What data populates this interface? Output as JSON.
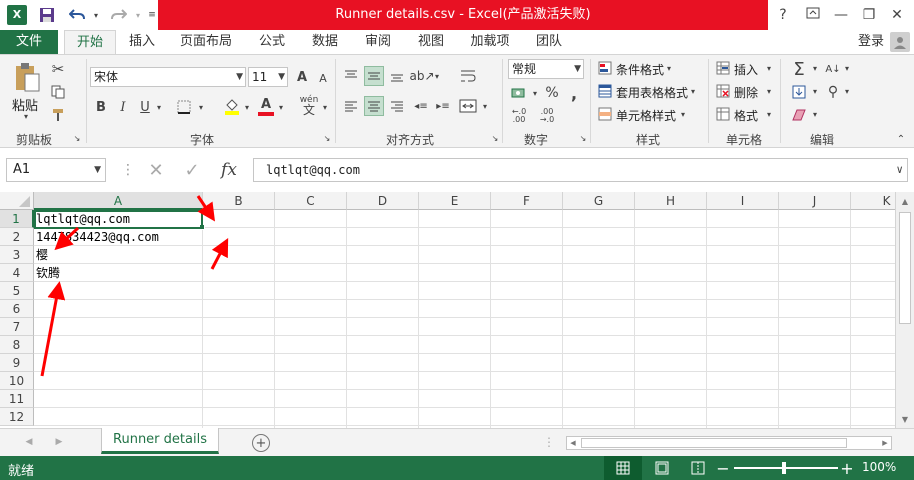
{
  "window": {
    "title": "Runner details.csv -  Excel(产品激活失败)",
    "logo": "X",
    "help": "?",
    "minimize": "—",
    "restore": "❐",
    "close": "✕"
  },
  "tabs": [
    "文件",
    "开始",
    "插入",
    "页面布局",
    "公式",
    "数据",
    "审阅",
    "视图",
    "加载项",
    "团队"
  ],
  "login": "登录",
  "ribbon": {
    "clipboard": {
      "paste": "粘贴",
      "label": "剪贴板"
    },
    "font": {
      "name": "宋体",
      "size": "11",
      "bold": "B",
      "italic": "I",
      "underline": "U",
      "label": "字体",
      "grow": "A",
      "shrink": "A",
      "fontcolor": "A",
      "phonetic": "wén"
    },
    "align": {
      "label": "对齐方式"
    },
    "number": {
      "format": "常规",
      "percent": "%",
      "comma": ",",
      "label": "数字"
    },
    "styles": {
      "cond": "条件格式",
      "table": "套用表格格式",
      "cell": "单元格样式",
      "label": "样式"
    },
    "cells": {
      "insert": "插入",
      "delete": "删除",
      "format": "格式",
      "label": "单元格"
    },
    "editing": {
      "label": "编辑"
    }
  },
  "formula": {
    "namebox": "A1",
    "value": "lqtlqt@qq.com",
    "fx": "fx"
  },
  "columns": [
    "A",
    "B",
    "C",
    "D",
    "E",
    "F",
    "G",
    "H",
    "I",
    "J",
    "K"
  ],
  "rows": [
    "1",
    "2",
    "3",
    "4",
    "5",
    "6",
    "7",
    "8",
    "9",
    "10",
    "11",
    "12"
  ],
  "cells": [
    {
      "row": 1,
      "text": "lqtlqt@qq.com"
    },
    {
      "row": 2,
      "text": "1447834423@qq.com"
    },
    {
      "row": 3,
      "text": "樱"
    },
    {
      "row": 4,
      "text": "钦腾"
    }
  ],
  "sheet": {
    "name": "Runner details",
    "add": "+"
  },
  "status": {
    "ready": "就绪",
    "zoom": "100%",
    "minus": "−",
    "plus": "+"
  },
  "colors": {
    "excel_green": "#217346",
    "title_red": "#e81123",
    "arrow_red": "#ff0000"
  }
}
